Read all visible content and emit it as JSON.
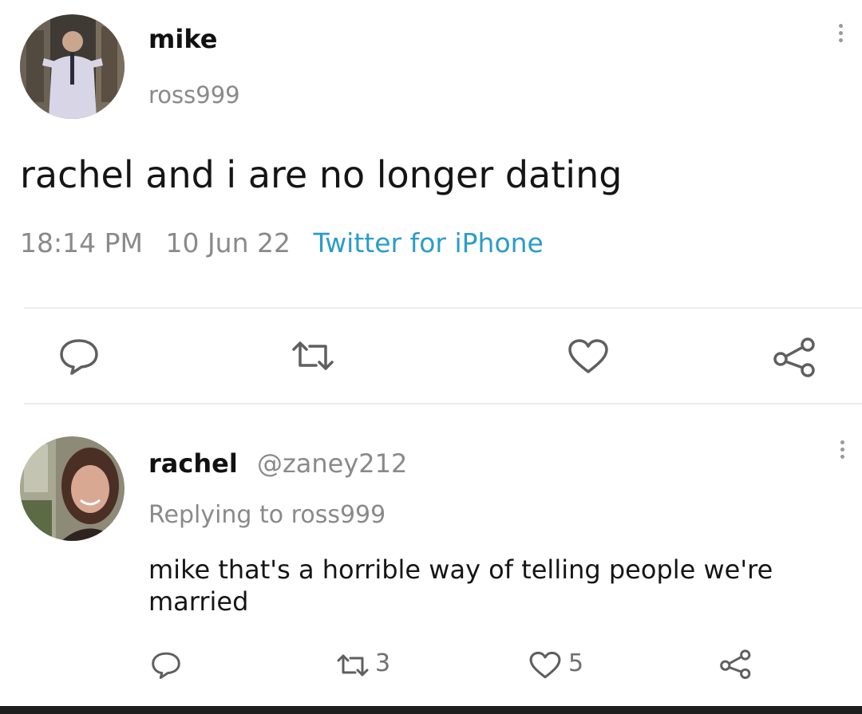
{
  "tweet": {
    "author": {
      "name": "mike",
      "handle": "ross999"
    },
    "text": "rachel and i are no longer dating",
    "time": "18:14 PM",
    "date": "10 Jun 22",
    "source": "Twitter for iPhone",
    "actions": [
      "comment-icon",
      "retweet-icon",
      "like-icon",
      "share-icon"
    ]
  },
  "reply": {
    "author": {
      "name": "rachel",
      "handle": "@zaney212"
    },
    "replying_to": "Replying to ross999",
    "text": "mike that's a horrible way of telling people we're married",
    "retweets": "3",
    "likes": "5",
    "actions": [
      "comment-icon",
      "retweet-icon",
      "like-icon",
      "share-icon"
    ]
  },
  "colors": {
    "link": "#2b9cc9",
    "muted": "#8a8a8a",
    "icon": "#5f5f5f",
    "divider": "#ececec"
  }
}
